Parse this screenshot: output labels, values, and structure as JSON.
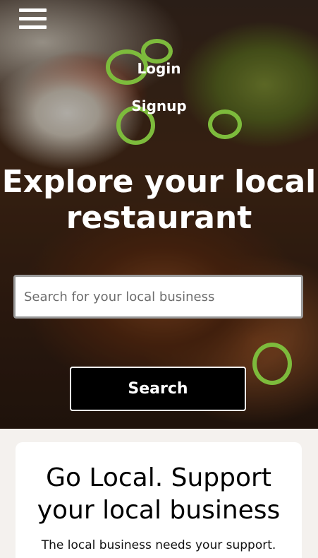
{
  "nav": {
    "menu_icon": "hamburger-icon",
    "login_label": "Login",
    "signup_label": "Signup"
  },
  "hero": {
    "headline_line1": "Explore your local",
    "headline_line2": "restaurant",
    "search_placeholder": "Search for your local business",
    "search_value": "",
    "search_button_label": "Search"
  },
  "card": {
    "title_line1": "Go Local. Support",
    "title_line2": "your local business",
    "text": "The local business needs your support."
  },
  "colors": {
    "button_bg": "#000000",
    "text_on_hero": "#ffffff"
  }
}
